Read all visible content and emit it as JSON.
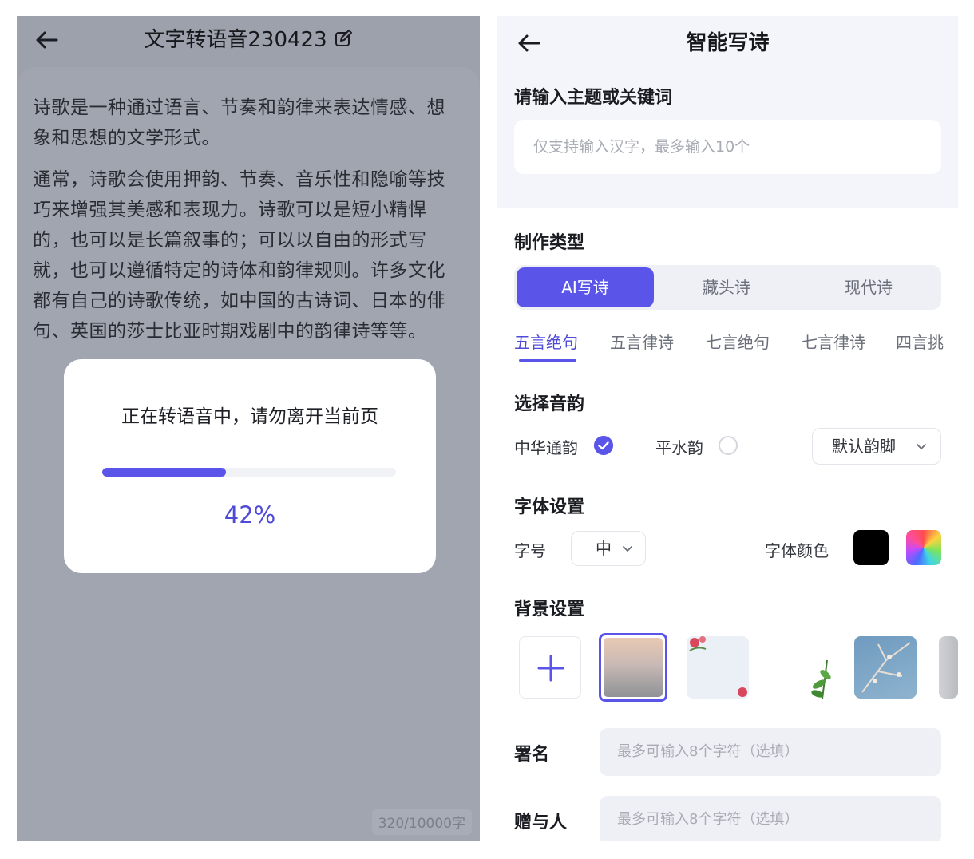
{
  "left_screen": {
    "title": "文字转语音230423",
    "icons": {
      "back": "back-arrow-icon",
      "edit": "edit-icon"
    },
    "paragraphs": [
      "诗歌是一种通过语言、节奏和韵律来表达情感、想象和思想的文学形式。",
      "通常，诗歌会使用押韵、节奏、音乐性和隐喻等技巧来增强其美感和表现力。诗歌可以是短小精悍的，也可以是长篇叙事的；可以以自由的形式写就，也可以遵循特定的诗体和韵律规则。许多文化都有自己的诗歌传统，如中国的古诗词、日本的俳句、英国的莎士比亚时期戏剧中的韵律诗等等。"
    ],
    "char_counter": "320/10000字",
    "dialog": {
      "message": "正在转语音中，请勿离开当前页",
      "progress": 0.42,
      "progress_label": "42%"
    }
  },
  "right_screen": {
    "title": "智能写诗",
    "icons": {
      "back": "back-arrow-icon"
    },
    "topic": {
      "label": "请输入主题或关键词",
      "placeholder": "仅支持输入汉字，最多输入10个"
    },
    "type_section": {
      "label": "制作类型",
      "segments": [
        "AI写诗",
        "藏头诗",
        "现代诗"
      ],
      "active_segment": 0,
      "sub_tabs": [
        "五言绝句",
        "五言律诗",
        "七言绝句",
        "七言律诗",
        "四言挑"
      ],
      "active_sub_tab": 0
    },
    "rhyme_section": {
      "label": "选择音韵",
      "options": [
        {
          "label": "中华通韵",
          "selected": true
        },
        {
          "label": "平水韵",
          "selected": false
        }
      ],
      "dropdown_value": "默认韵脚"
    },
    "font_section": {
      "label": "字体设置",
      "size_label": "字号",
      "size_value": "中",
      "color_label": "字体颜色",
      "color_swatch": "#000000"
    },
    "background_section": {
      "label": "背景设置",
      "add_icon": "plus-icon",
      "selected_index": 0
    },
    "signature": {
      "label": "署名",
      "placeholder": "最多可输入8个字符（选填）"
    },
    "recipient": {
      "label": "赠与人",
      "placeholder": "最多可输入8个字符（选填）"
    }
  },
  "colors": {
    "accent": "#5a55e8",
    "overlay_bg": "#9da1ac"
  }
}
